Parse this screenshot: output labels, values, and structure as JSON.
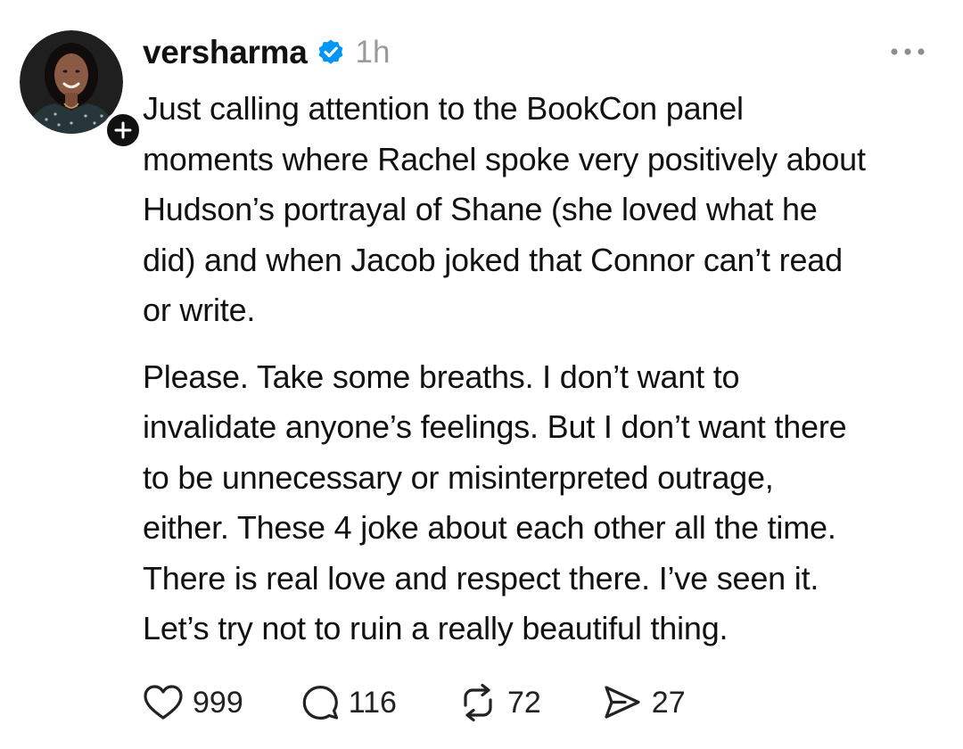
{
  "post": {
    "username": "versharma",
    "verified": true,
    "timestamp": "1h",
    "more_icon": "more-horizontal-icon",
    "paragraphs": [
      "Just calling attention to the BookCon panel\nmoments where Rachel spoke very positively about\nHudson’s portrayal of Shane (she loved what he\ndid) and when Jacob joked that Connor can’t read\nor write.",
      "Please. Take some breaths. I don’t want to\ninvalidate anyone’s feelings. But I don’t want there\nto be unnecessary or misinterpreted outrage,\neither. These 4 joke about each other all the time.\nThere is real love and respect there. I’ve seen it.\nLet’s try not to ruin a really beautiful thing."
    ],
    "actions": {
      "likes": "999",
      "replies": "116",
      "reposts": "72",
      "shares": "27"
    }
  },
  "colors": {
    "text": "#111111",
    "muted": "#9a9a9a",
    "verified_blue": "#0095f6"
  }
}
